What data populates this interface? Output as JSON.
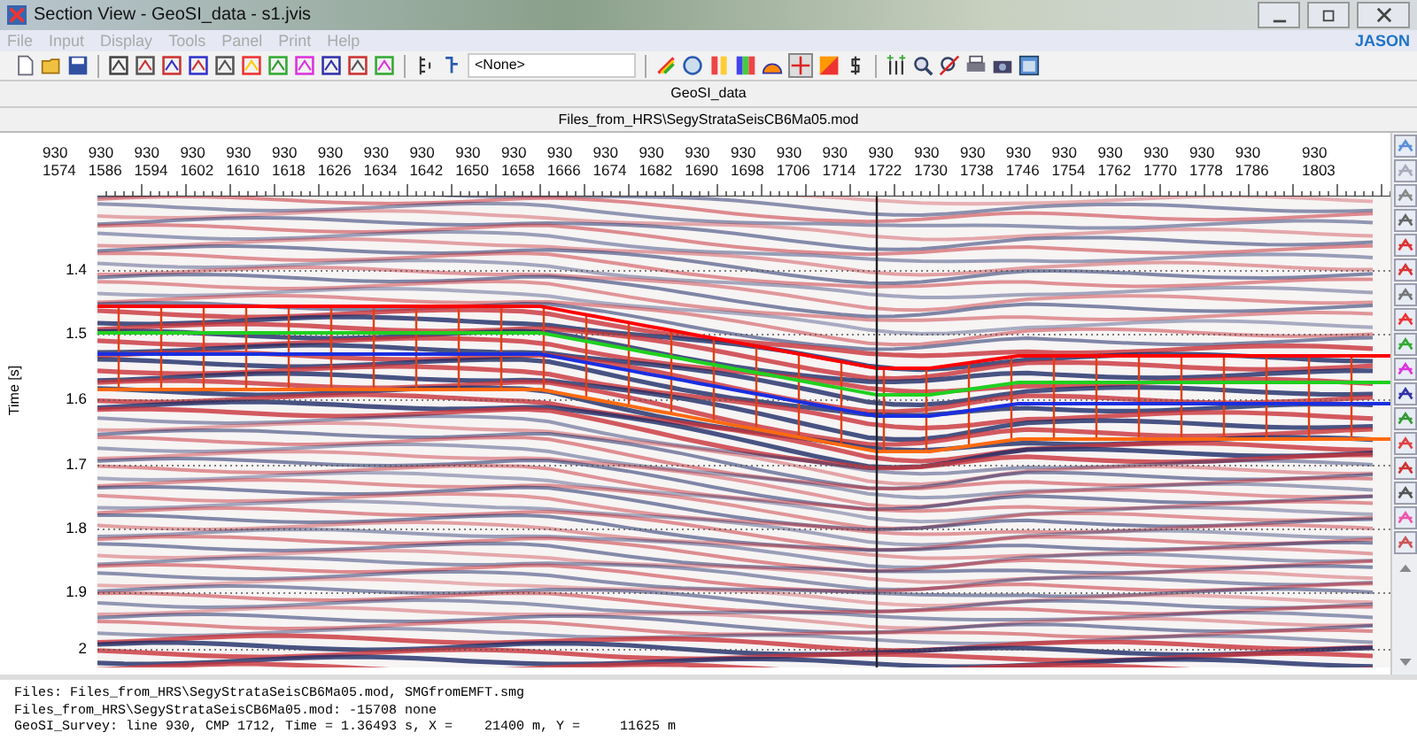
{
  "window": {
    "title": "Section View - GeoSI_data - s1.jvis"
  },
  "menu": [
    "File",
    "Input",
    "Display",
    "Tools",
    "Panel",
    "Print",
    "Help"
  ],
  "logo": "JASON",
  "toolbar": {
    "dropdown_value": "<None>"
  },
  "dataset_header": "GeoSI_data",
  "file_header": "Files_from_HRS\\SegyStrataSeisCB6Ma05.mod",
  "section": {
    "column_labels": [
      [
        "930",
        "1574"
      ],
      [
        "930",
        "1586"
      ],
      [
        "930",
        "1594"
      ],
      [
        "930",
        "1602"
      ],
      [
        "930",
        "1610"
      ],
      [
        "930",
        "1618"
      ],
      [
        "930",
        "1626"
      ],
      [
        "930",
        "1634"
      ],
      [
        "930",
        "1642"
      ],
      [
        "930",
        "1650"
      ],
      [
        "930",
        "1658"
      ],
      [
        "930",
        "1666"
      ],
      [
        "930",
        "1674"
      ],
      [
        "930",
        "1682"
      ],
      [
        "930",
        "1690"
      ],
      [
        "930",
        "1698"
      ],
      [
        "930",
        "1706"
      ],
      [
        "930",
        "1714"
      ],
      [
        "930",
        "1722"
      ],
      [
        "930",
        "1730"
      ],
      [
        "930",
        "1738"
      ],
      [
        "930",
        "1746"
      ],
      [
        "930",
        "1754"
      ],
      [
        "930",
        "1762"
      ],
      [
        "930",
        "1770"
      ],
      [
        "930",
        "1778"
      ],
      [
        "930",
        "1786"
      ],
      [
        "930",
        "1803"
      ]
    ],
    "ylabel": "Time [s]",
    "yticks": [
      "1.4",
      "1.5",
      "1.6",
      "1.7",
      "1.8",
      "1.9",
      "2"
    ]
  },
  "status_lines": [
    "Files: Files_from_HRS\\SegyStrataSeisCB6Ma05.mod, SMGfromEMFT.smg",
    "Files_from_HRS\\SegyStrataSeisCB6Ma05.mod: -15708 none",
    "GeoSI_Survey: line 930, CMP 1712, Time = 1.36493 s, X =    21400 m, Y =     11625 m"
  ]
}
